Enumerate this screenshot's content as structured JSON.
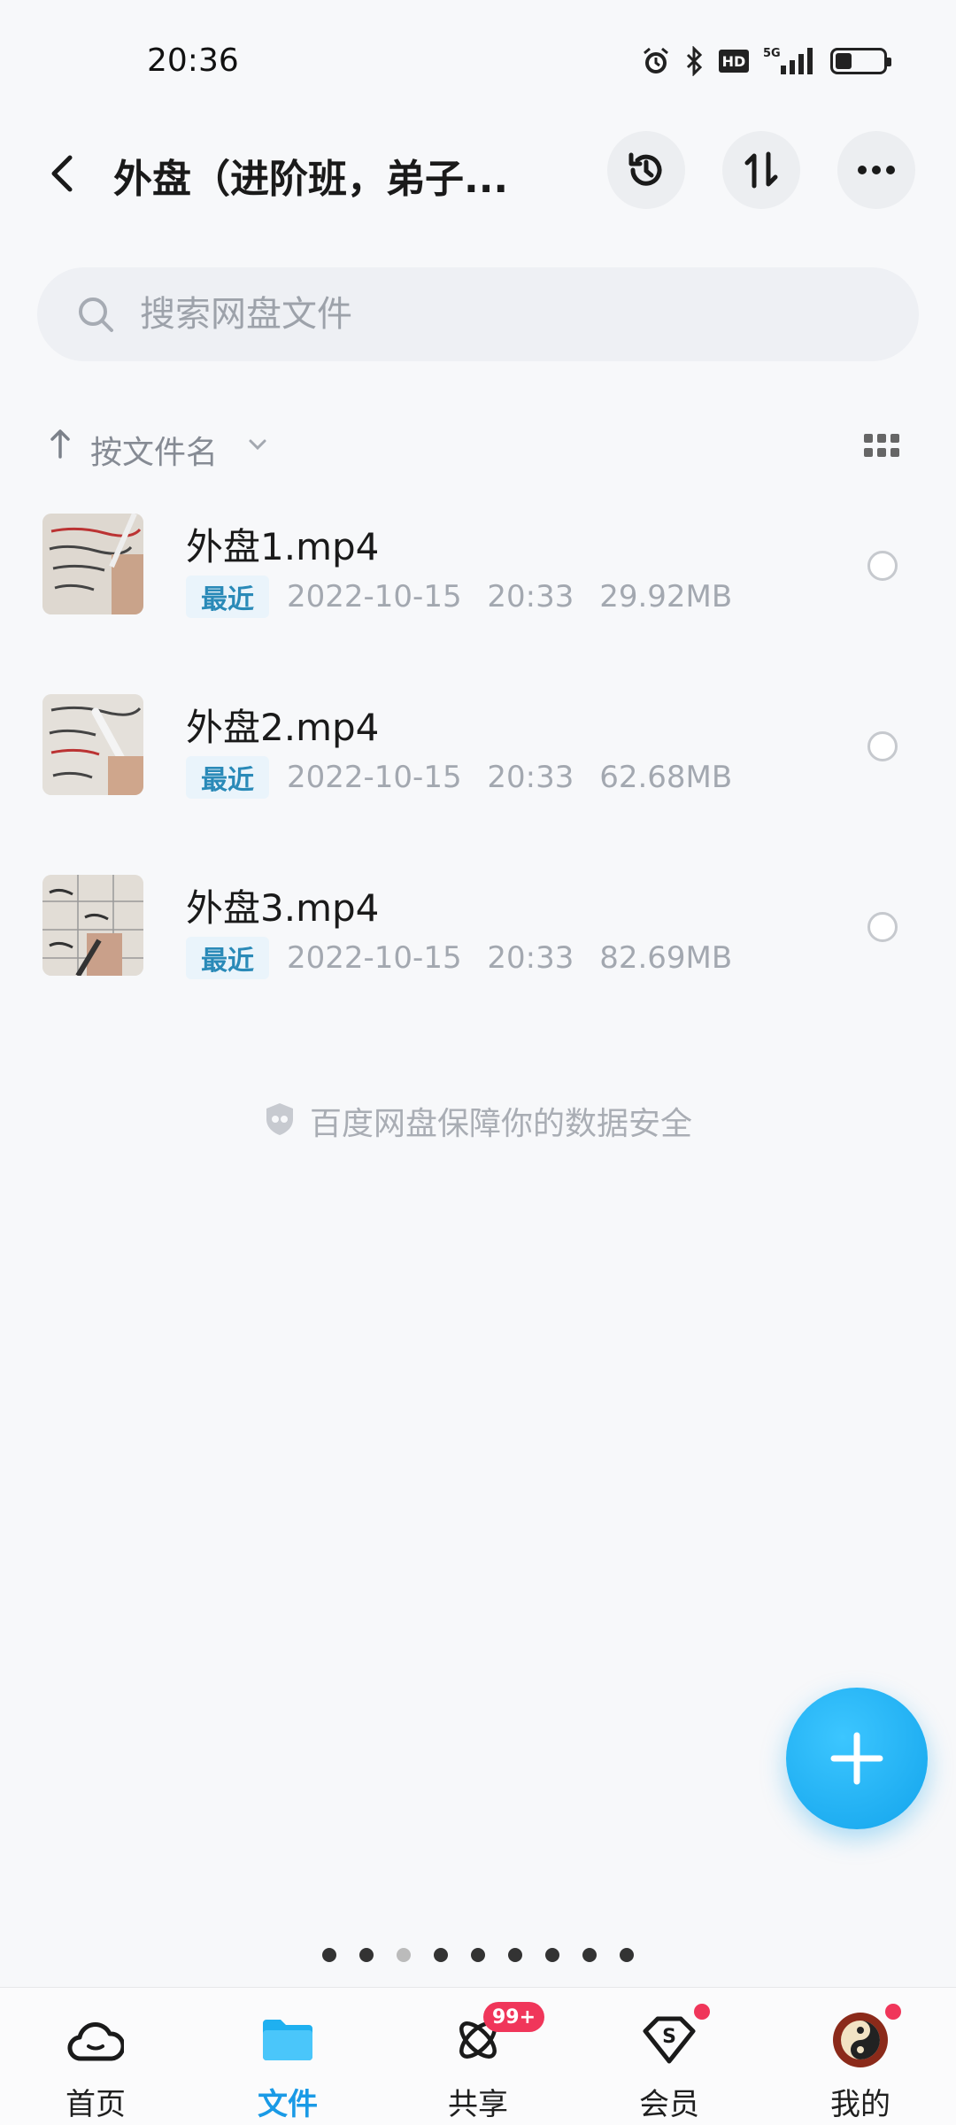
{
  "status": {
    "time": "20:36",
    "hd": "HD",
    "network": "5G",
    "battery_level": 0.35
  },
  "header": {
    "title": "外盘（进阶班，弟子..."
  },
  "search": {
    "placeholder": "搜索网盘文件"
  },
  "sort": {
    "label": "按文件名"
  },
  "files": [
    {
      "name": "外盘1.mp4",
      "badge": "最近",
      "date": "2022-10-15",
      "time": "20:33",
      "size": "29.92MB"
    },
    {
      "name": "外盘2.mp4",
      "badge": "最近",
      "date": "2022-10-15",
      "time": "20:33",
      "size": "62.68MB"
    },
    {
      "name": "外盘3.mp4",
      "badge": "最近",
      "date": "2022-10-15",
      "time": "20:33",
      "size": "82.69MB"
    }
  ],
  "footer_note": "百度网盘保障你的数据安全",
  "tabs": [
    {
      "label": "首页",
      "icon": "cloud-icon"
    },
    {
      "label": "文件",
      "icon": "folder-icon",
      "active": true
    },
    {
      "label": "共享",
      "icon": "share-atom-icon",
      "badge": "99+"
    },
    {
      "label": "会员",
      "icon": "vip-diamond-icon"
    },
    {
      "label": "我的",
      "icon": "avatar-icon"
    }
  ],
  "colors": {
    "accent": "#1a9ae6",
    "fab": "#13a4ec",
    "badge_red": "#f0365a"
  }
}
